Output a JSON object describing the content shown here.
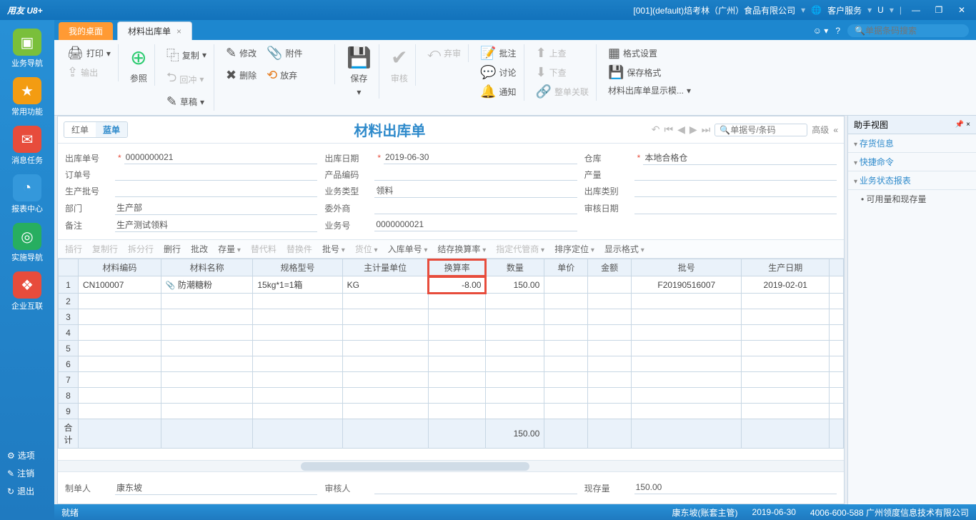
{
  "titlebar": {
    "logo": "用友 U8+",
    "company": "[001](default)焙考林（广州）食品有限公司",
    "service": "客户服务",
    "uchar": "U"
  },
  "leftnav": {
    "items": [
      {
        "label": "业务导航",
        "color": "#7abf3b"
      },
      {
        "label": "常用功能",
        "color": "#f39c12"
      },
      {
        "label": "消息任务",
        "color": "#e74c3c"
      },
      {
        "label": "报表中心",
        "color": "#3498db"
      },
      {
        "label": "实施导航",
        "color": "#27ae60"
      },
      {
        "label": "企业互联",
        "color": "#e74c3c"
      }
    ],
    "bottom": [
      {
        "icon": "⚙",
        "label": "选项"
      },
      {
        "icon": "✎",
        "label": "注销"
      },
      {
        "icon": "↻",
        "label": "退出"
      }
    ]
  },
  "tabs": {
    "items": [
      {
        "label": "我的桌面",
        "active": false
      },
      {
        "label": "材料出库单",
        "active": true
      }
    ],
    "search_placeholder": "单据条码搜索"
  },
  "toolbar": {
    "print": "打印",
    "output": "输出",
    "ref": "参照",
    "copy": "复制",
    "reverse": "回冲",
    "draft": "草稿",
    "edit": "修改",
    "delete": "删除",
    "attach": "附件",
    "discard": "放弃",
    "save": "保存",
    "audit": "审核",
    "abandon": "弃审",
    "batch": "批注",
    "discuss": "讨论",
    "notify": "通知",
    "up": "上查",
    "down": "下查",
    "wholerel": "整单关联",
    "formatset": "格式设置",
    "saveformat": "保存格式",
    "displaytpl": "材料出库单显示模..."
  },
  "doc": {
    "red": "红单",
    "blue": "蓝单",
    "title": "材料出库单",
    "locator_placeholder": "单据号/条码",
    "advanced": "高级"
  },
  "form": {
    "l_outno": "出库单号",
    "v_outno": "0000000021",
    "l_outdate": "出库日期",
    "v_outdate": "2019-06-30",
    "l_whs": "仓库",
    "v_whs": "本地合格仓",
    "l_orderno": "订单号",
    "v_orderno": "",
    "l_prodcode": "产品编码",
    "v_prodcode": "",
    "l_qty": "产量",
    "v_qty": "",
    "l_lot": "生产批号",
    "v_lot": "",
    "l_biztype": "业务类型",
    "v_biztype": "领料",
    "l_outtype": "出库类别",
    "v_outtype": "",
    "l_dept": "部门",
    "v_dept": "生产部",
    "l_outsrc": "委外商",
    "v_outsrc": "",
    "l_auditdate": "审核日期",
    "v_auditdate": "",
    "l_remark": "备注",
    "v_remark": "生产测试领料",
    "l_bizno": "业务号",
    "v_bizno": "0000000021"
  },
  "gridtoolbar": [
    "插行",
    "复制行",
    "拆分行",
    "删行",
    "批改",
    "存量",
    "替代料",
    "替换件",
    "批号",
    "货位",
    "入库单号",
    "结存换算率",
    "指定代管商",
    "排序定位",
    "显示格式"
  ],
  "grid": {
    "headers": [
      "",
      "材料编码",
      "材料名称",
      "规格型号",
      "主计量单位",
      "换算率",
      "数量",
      "单价",
      "金额",
      "批号",
      "生产日期"
    ],
    "row1": {
      "code": "CN100007",
      "name": "防潮糖粉",
      "spec": "15kg*1=1箱",
      "uom": "KG",
      "rate": "-8.00",
      "qty": "150.00",
      "price": "",
      "amt": "",
      "lot": "F20190516007",
      "pdate": "2019-02-01"
    },
    "sum_label": "合计",
    "sum_qty": "150.00"
  },
  "footer": {
    "l_maker": "制单人",
    "v_maker": "康东坡",
    "l_auditor": "审核人",
    "v_auditor": "",
    "l_onhand": "现存量",
    "v_onhand": "150.00"
  },
  "rightpanel": {
    "title": "助手视图",
    "s1": "存货信息",
    "s2": "快捷命令",
    "s3": "业务状态报表",
    "i1": "可用量和现存量"
  },
  "status": {
    "ready": "就绪",
    "user": "康东坡(账套主管)",
    "date": "2019-06-30",
    "tel": "4006-600-588 广州领度信息技术有限公司"
  }
}
